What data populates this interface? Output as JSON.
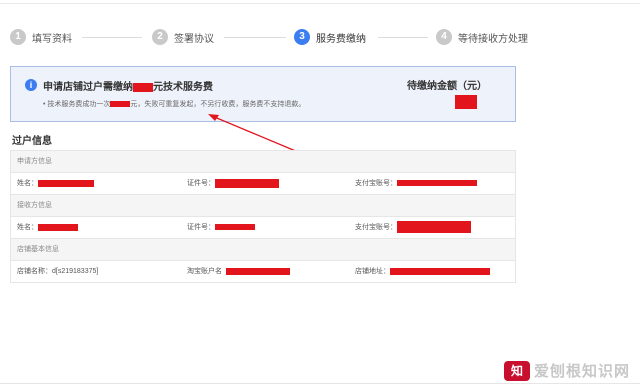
{
  "steps": [
    {
      "num": "1",
      "label": "填写资料"
    },
    {
      "num": "2",
      "label": "签署协议"
    },
    {
      "num": "3",
      "label": "服务费缴纳"
    },
    {
      "num": "4",
      "label": "等待接收方处理"
    }
  ],
  "notice": {
    "icon": "i",
    "title_prefix": "申请店铺过户需缴纳",
    "title_suffix": "元技术服务费",
    "desc_prefix": "• 技术服务费成功一次",
    "desc_suffix": "元，失败可重复发起，不另行收费，服务费不支持退款。",
    "amount_label": "待缴纳金额（元）"
  },
  "section_title": "过户信息",
  "applicant": {
    "heading": "申请方信息",
    "name_label": "姓名：",
    "id_label": "证件号：",
    "alipay_label": "支付宝账号："
  },
  "receiver": {
    "heading": "接收方信息",
    "name_label": "姓名：",
    "id_label": "证件号：",
    "alipay_label": "支付宝账号："
  },
  "shop": {
    "heading": "店铺基本信息",
    "name_label": "店铺名称：",
    "name_value": "d[s219183375]",
    "account_label": "淘宝账户名",
    "address_label": "店铺地址："
  },
  "watermark": {
    "logo_text": "知",
    "text": "爱刨根知识网"
  },
  "colors": {
    "accent": "#3d7df2",
    "redaction": "#e2151d",
    "notice_bg": "#eef3fb",
    "notice_border": "#a9bee2"
  }
}
